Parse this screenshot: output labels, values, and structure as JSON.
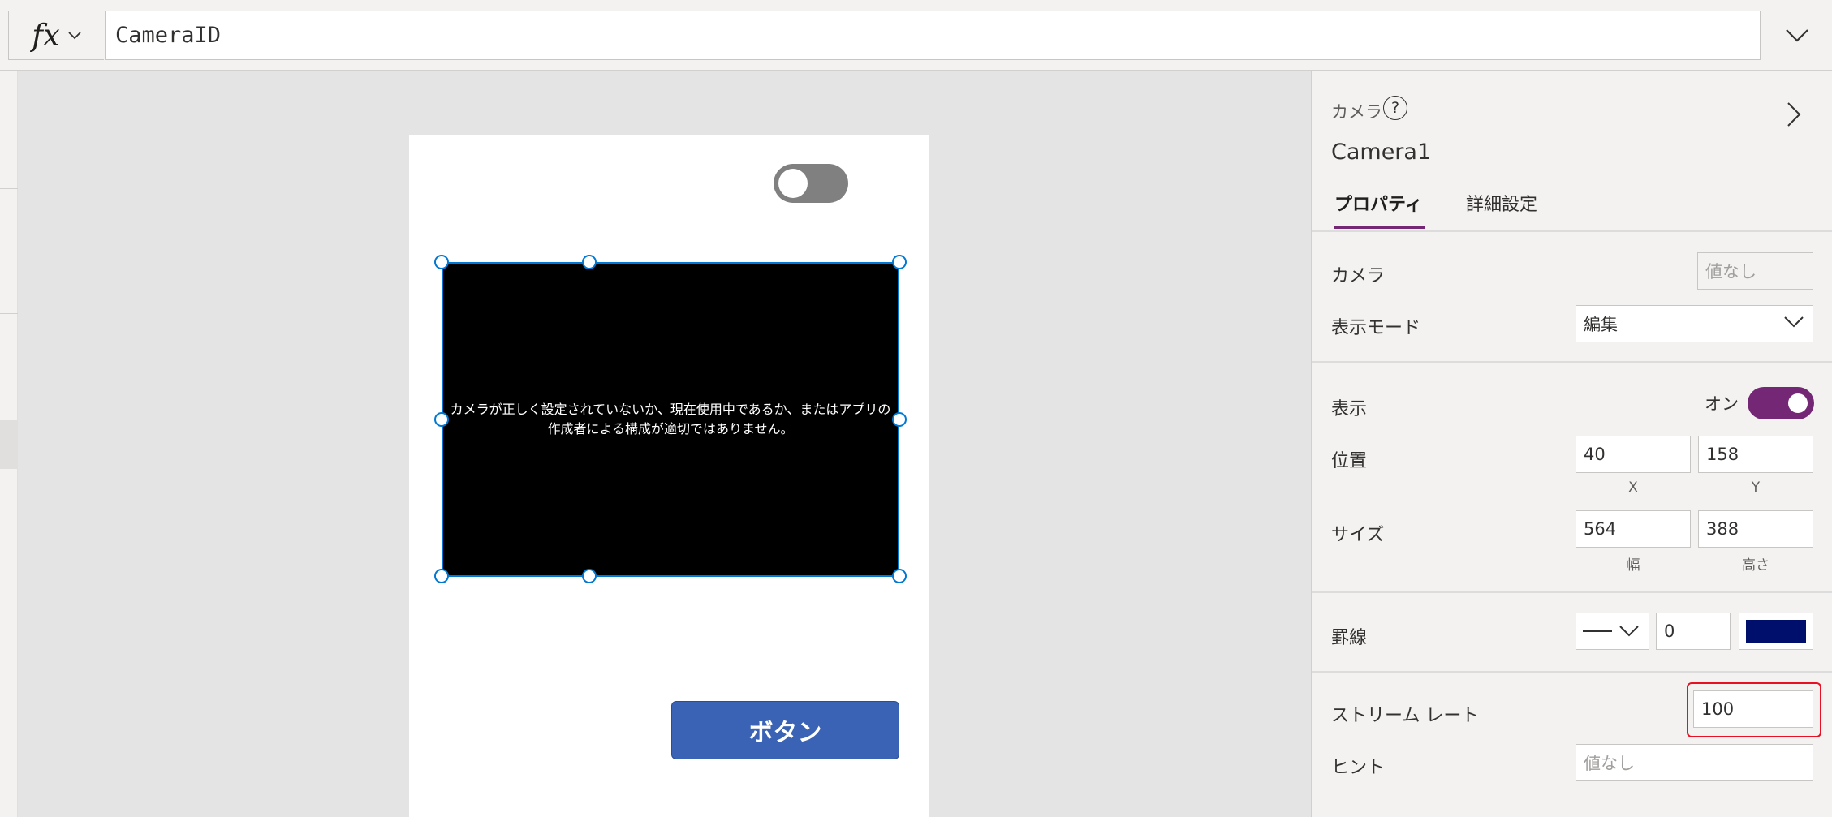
{
  "formula_bar": {
    "fx_label": "fx",
    "formula": "CameraID"
  },
  "canvas": {
    "camera_message": "カメラが正しく設定されていないか、現在使用中であるか、またはアプリの作成者による構成が適切ではありません。",
    "button_label": "ボタン",
    "toggle_state": "off"
  },
  "properties": {
    "control_type": "カメラ",
    "help_glyph": "?",
    "control_name": "Camera1",
    "tabs": [
      {
        "label": "プロパティ",
        "active": true
      },
      {
        "label": "詳細設定",
        "active": false
      }
    ],
    "camera": {
      "label": "カメラ",
      "placeholder": "値なし"
    },
    "display_mode": {
      "label": "表示モード",
      "value": "編集"
    },
    "visible": {
      "label": "表示",
      "state": "オン"
    },
    "position": {
      "label": "位置",
      "x": "40",
      "y": "158",
      "x_caption": "X",
      "y_caption": "Y"
    },
    "size": {
      "label": "サイズ",
      "width": "564",
      "height": "388",
      "width_caption": "幅",
      "height_caption": "高さ"
    },
    "border": {
      "label": "罫線",
      "thickness": "0",
      "color": "#000f6b"
    },
    "stream_rate": {
      "label": "ストリーム レート",
      "value": "100"
    },
    "hint": {
      "label": "ヒント",
      "placeholder": "値なし"
    }
  },
  "colors": {
    "accent": "#742774",
    "selection": "#0078d4",
    "button": "#3a63b5",
    "highlight": "#e81123"
  }
}
